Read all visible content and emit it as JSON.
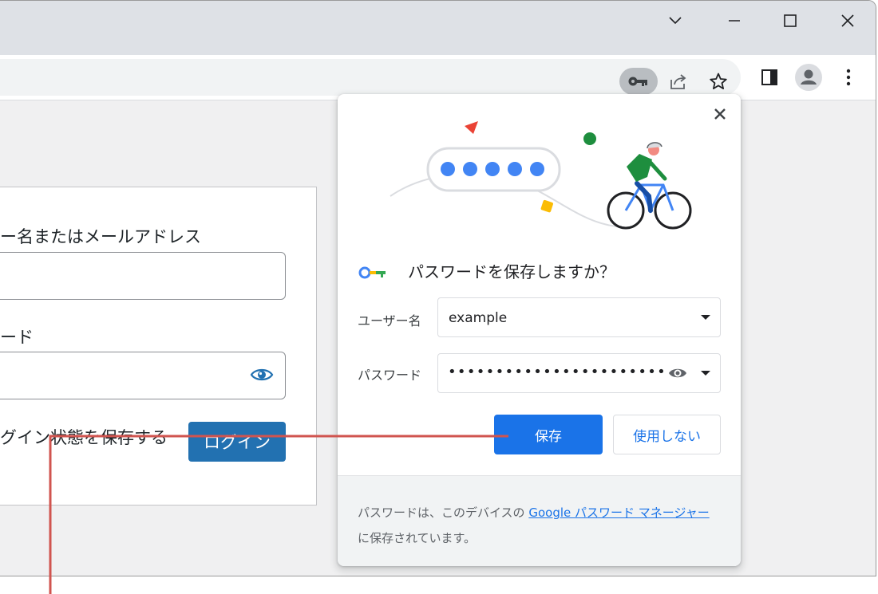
{
  "window": {
    "controls": [
      "chevron-down",
      "minimize",
      "maximize",
      "close"
    ]
  },
  "toolbar": {
    "icons": [
      "key-icon",
      "share-icon",
      "star-icon",
      "side-panel-icon",
      "profile-icon",
      "more-menu-icon"
    ]
  },
  "login_form": {
    "username_label": "ー名またはメールアドレス",
    "password_label": "ード",
    "remember_label": "グイン状態を保存する",
    "login_button": "ログイン"
  },
  "save_password_bubble": {
    "title": "パスワードを保存しますか？",
    "username_label": "ユーザー名",
    "username_value": "example",
    "password_label": "パスワード",
    "password_mask": "•••••••••••••••••••••••",
    "save_button": "保存",
    "never_button": "使用しない",
    "footer_text_before": "パスワードは、このデバイスの",
    "footer_link": "Google パスワード マネージャー",
    "footer_text_after": "に保存されています。"
  },
  "colors": {
    "accent": "#1a73e8",
    "wp_button": "#2271b1",
    "callout_line": "#d0544f"
  }
}
